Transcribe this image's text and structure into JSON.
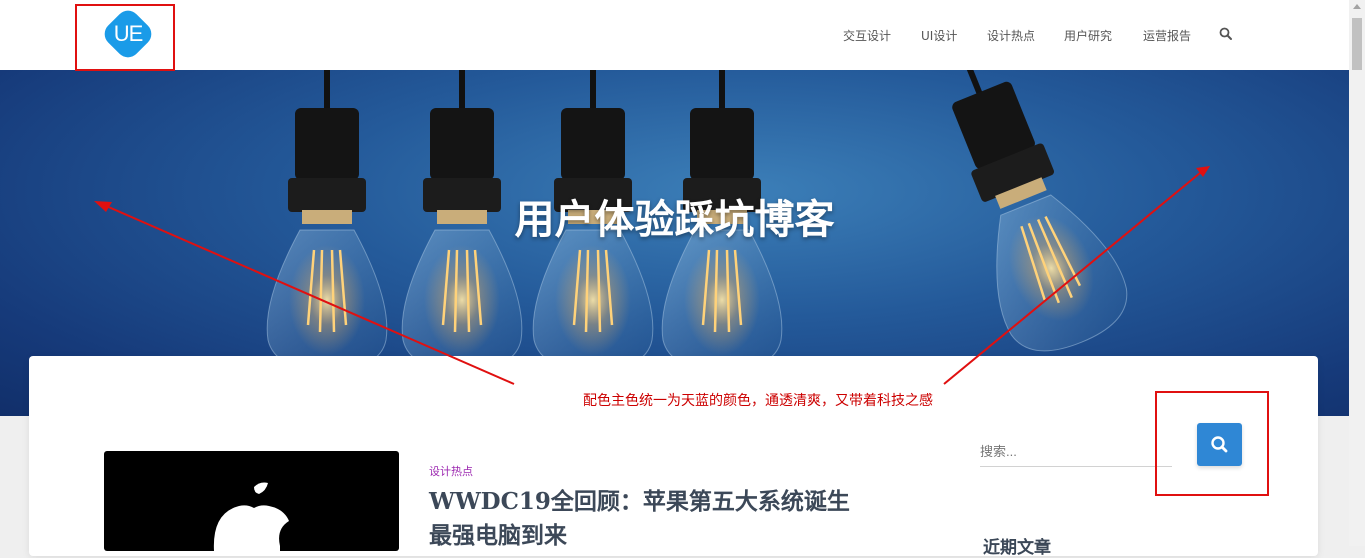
{
  "header": {
    "logo_text": "UE",
    "nav": [
      {
        "label": "交互设计"
      },
      {
        "label": "UI设计"
      },
      {
        "label": "设计热点"
      },
      {
        "label": "用户研究"
      },
      {
        "label": "运营报告"
      }
    ]
  },
  "hero": {
    "title": "用户体验踩坑博客"
  },
  "annotation": {
    "note": "配色主色统一为天蓝的颜色，通透清爽，又带着科技之感"
  },
  "article": {
    "category": "设计热点",
    "title": "WWDC19全回顾：苹果第五大系统诞生 最强电脑到来"
  },
  "sidebar": {
    "search_placeholder": "搜索...",
    "recent_heading": "近期文章"
  },
  "colors": {
    "brand_blue": "#1a9be8",
    "button_blue": "#2f87d5",
    "annotation_red": "#e01010",
    "category_purple": "#9c27b0"
  },
  "icons": [
    "search-icon",
    "logo-icon",
    "apple-logo-icon",
    "light-bulb-icon"
  ]
}
